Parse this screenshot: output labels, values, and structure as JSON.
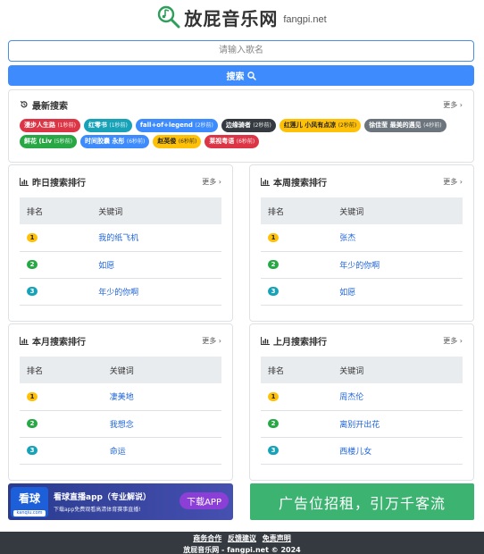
{
  "site": {
    "title": "放屁音乐网",
    "domain": "fangpi.net"
  },
  "search": {
    "placeholder": "请输入歌名",
    "button": "搜索"
  },
  "recent": {
    "title": "最新搜索",
    "more": "更多",
    "tags": [
      {
        "text": "漫步人生路",
        "ago": "(1秒前)",
        "color": "#dc3545"
      },
      {
        "text": "红零书",
        "ago": "(1秒前)",
        "color": "#17a2b8"
      },
      {
        "text": "fall+of+legend",
        "ago": "(2秒前)",
        "color": "#3d8bfd"
      },
      {
        "text": "边缘骑者",
        "ago": "(2秒前)",
        "color": "#343a40"
      },
      {
        "text": "红莲儿 小风有点凉",
        "ago": "(2秒前)",
        "color": "#ffc107"
      },
      {
        "text": "徐佳莹 最美的遇见",
        "ago": "(4秒前)",
        "color": "#6c757d"
      },
      {
        "text": "鲜花 (Liv",
        "ago": "(5秒前)",
        "color": "#28a745"
      },
      {
        "text": "时间胶囊 永彤",
        "ago": "(6秒前)",
        "color": "#3d8bfd"
      },
      {
        "text": "赵英俊",
        "ago": "(6秒前)",
        "color": "#ffc107"
      },
      {
        "text": "莱视粤语",
        "ago": "(6秒前)",
        "color": "#dc3545"
      }
    ]
  },
  "columns": {
    "rank": "排名",
    "keyword": "关键词"
  },
  "rankings": [
    {
      "title": "昨日搜索排行",
      "more": "更多",
      "rows": [
        "我的纸飞机",
        "如愿",
        "年少的你啊"
      ]
    },
    {
      "title": "本周搜索排行",
      "more": "更多",
      "rows": [
        "张杰",
        "年少的你啊",
        "如愿"
      ]
    },
    {
      "title": "本月搜索排行",
      "more": "更多",
      "rows": [
        "凄美地",
        "我想念",
        "命运"
      ]
    },
    {
      "title": "上月搜索排行",
      "more": "更多",
      "rows": [
        "周杰伦",
        "离别开出花",
        "西楼儿女"
      ]
    }
  ],
  "ads": {
    "left": {
      "logo": "看球",
      "logo_sub": "kanqiu.com",
      "title": "看球直播app（专业解说）",
      "sub": "下载app免费观看高清体育赛事直播!",
      "button": "下载APP"
    },
    "right": {
      "text": "广告位招租，引万千客流"
    }
  },
  "footer": {
    "links": [
      "商务合作",
      "反馈建议",
      "免责声明"
    ],
    "copyright": "放屁音乐网 - fangpi.net © 2024"
  }
}
